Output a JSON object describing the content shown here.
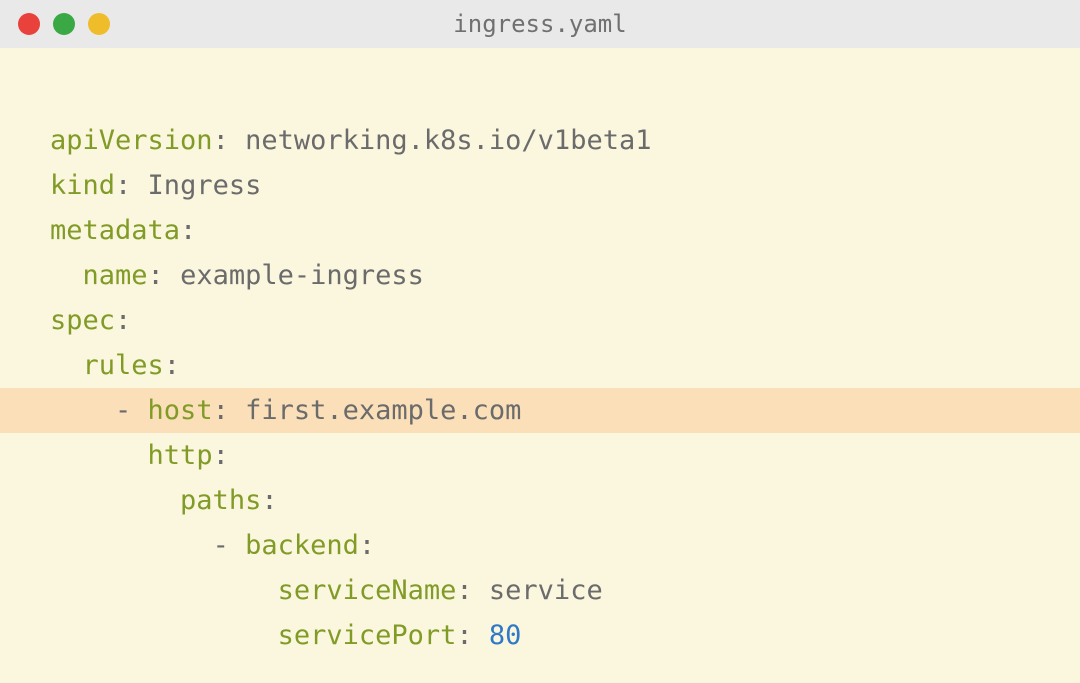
{
  "window": {
    "title": "ingress.yaml"
  },
  "code": {
    "lines": [
      {
        "indent": 0,
        "key": "apiVersion",
        "value": "networking.k8s.io/v1beta1",
        "type": "string",
        "dash": false,
        "highlighted": false
      },
      {
        "indent": 0,
        "key": "kind",
        "value": "Ingress",
        "type": "string",
        "dash": false,
        "highlighted": false
      },
      {
        "indent": 0,
        "key": "metadata",
        "value": "",
        "type": "none",
        "dash": false,
        "highlighted": false
      },
      {
        "indent": 2,
        "key": "name",
        "value": "example-ingress",
        "type": "string",
        "dash": false,
        "highlighted": false
      },
      {
        "indent": 0,
        "key": "spec",
        "value": "",
        "type": "none",
        "dash": false,
        "highlighted": false
      },
      {
        "indent": 2,
        "key": "rules",
        "value": "",
        "type": "none",
        "dash": false,
        "highlighted": false
      },
      {
        "indent": 4,
        "key": "host",
        "value": "first.example.com",
        "type": "string",
        "dash": true,
        "highlighted": true
      },
      {
        "indent": 6,
        "key": "http",
        "value": "",
        "type": "none",
        "dash": false,
        "highlighted": false
      },
      {
        "indent": 8,
        "key": "paths",
        "value": "",
        "type": "none",
        "dash": false,
        "highlighted": false
      },
      {
        "indent": 10,
        "key": "backend",
        "value": "",
        "type": "none",
        "dash": true,
        "highlighted": false
      },
      {
        "indent": 14,
        "key": "serviceName",
        "value": "service",
        "type": "string",
        "dash": false,
        "highlighted": false
      },
      {
        "indent": 14,
        "key": "servicePort",
        "value": "80",
        "type": "number",
        "dash": false,
        "highlighted": false
      }
    ]
  }
}
